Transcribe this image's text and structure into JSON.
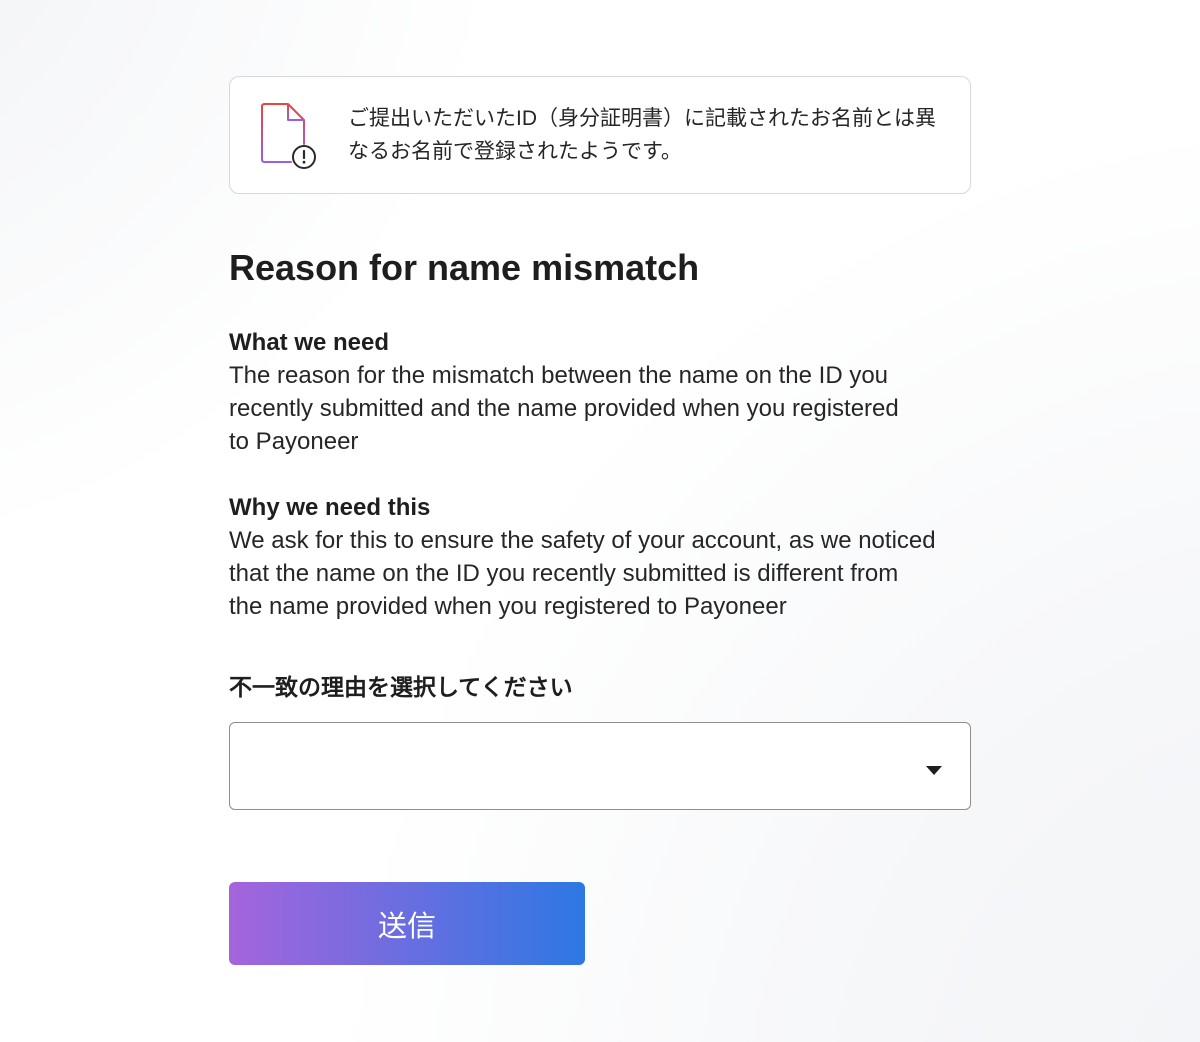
{
  "alert": {
    "icon": "document-warning-icon",
    "message": "ご提出いただいたID（身分証明書）に記載されたお名前とは異なるお名前で登録されたようです。"
  },
  "page_title": "Reason for name mismatch",
  "sections": [
    {
      "title": "What we need",
      "body": "The reason for the mismatch between the name on the ID you\nrecently submitted and the name provided when you registered\nto Payoneer"
    },
    {
      "title": "Why we need this",
      "body": "We ask for this to ensure the safety of your account, as we noticed\nthat the name on the ID you recently submitted is different from\nthe name provided when you registered to Payoneer"
    }
  ],
  "reason_field": {
    "label": "不一致の理由を選択してください",
    "value": "",
    "icon": "caret-down-icon"
  },
  "submit_button": {
    "label": "送信"
  },
  "colors": {
    "gradient_start": "#a564dc",
    "gradient_end": "#2d78e4",
    "icon_gradient_start": "#e8453c",
    "icon_gradient_end": "#9a5ee3",
    "text": "#222222"
  }
}
